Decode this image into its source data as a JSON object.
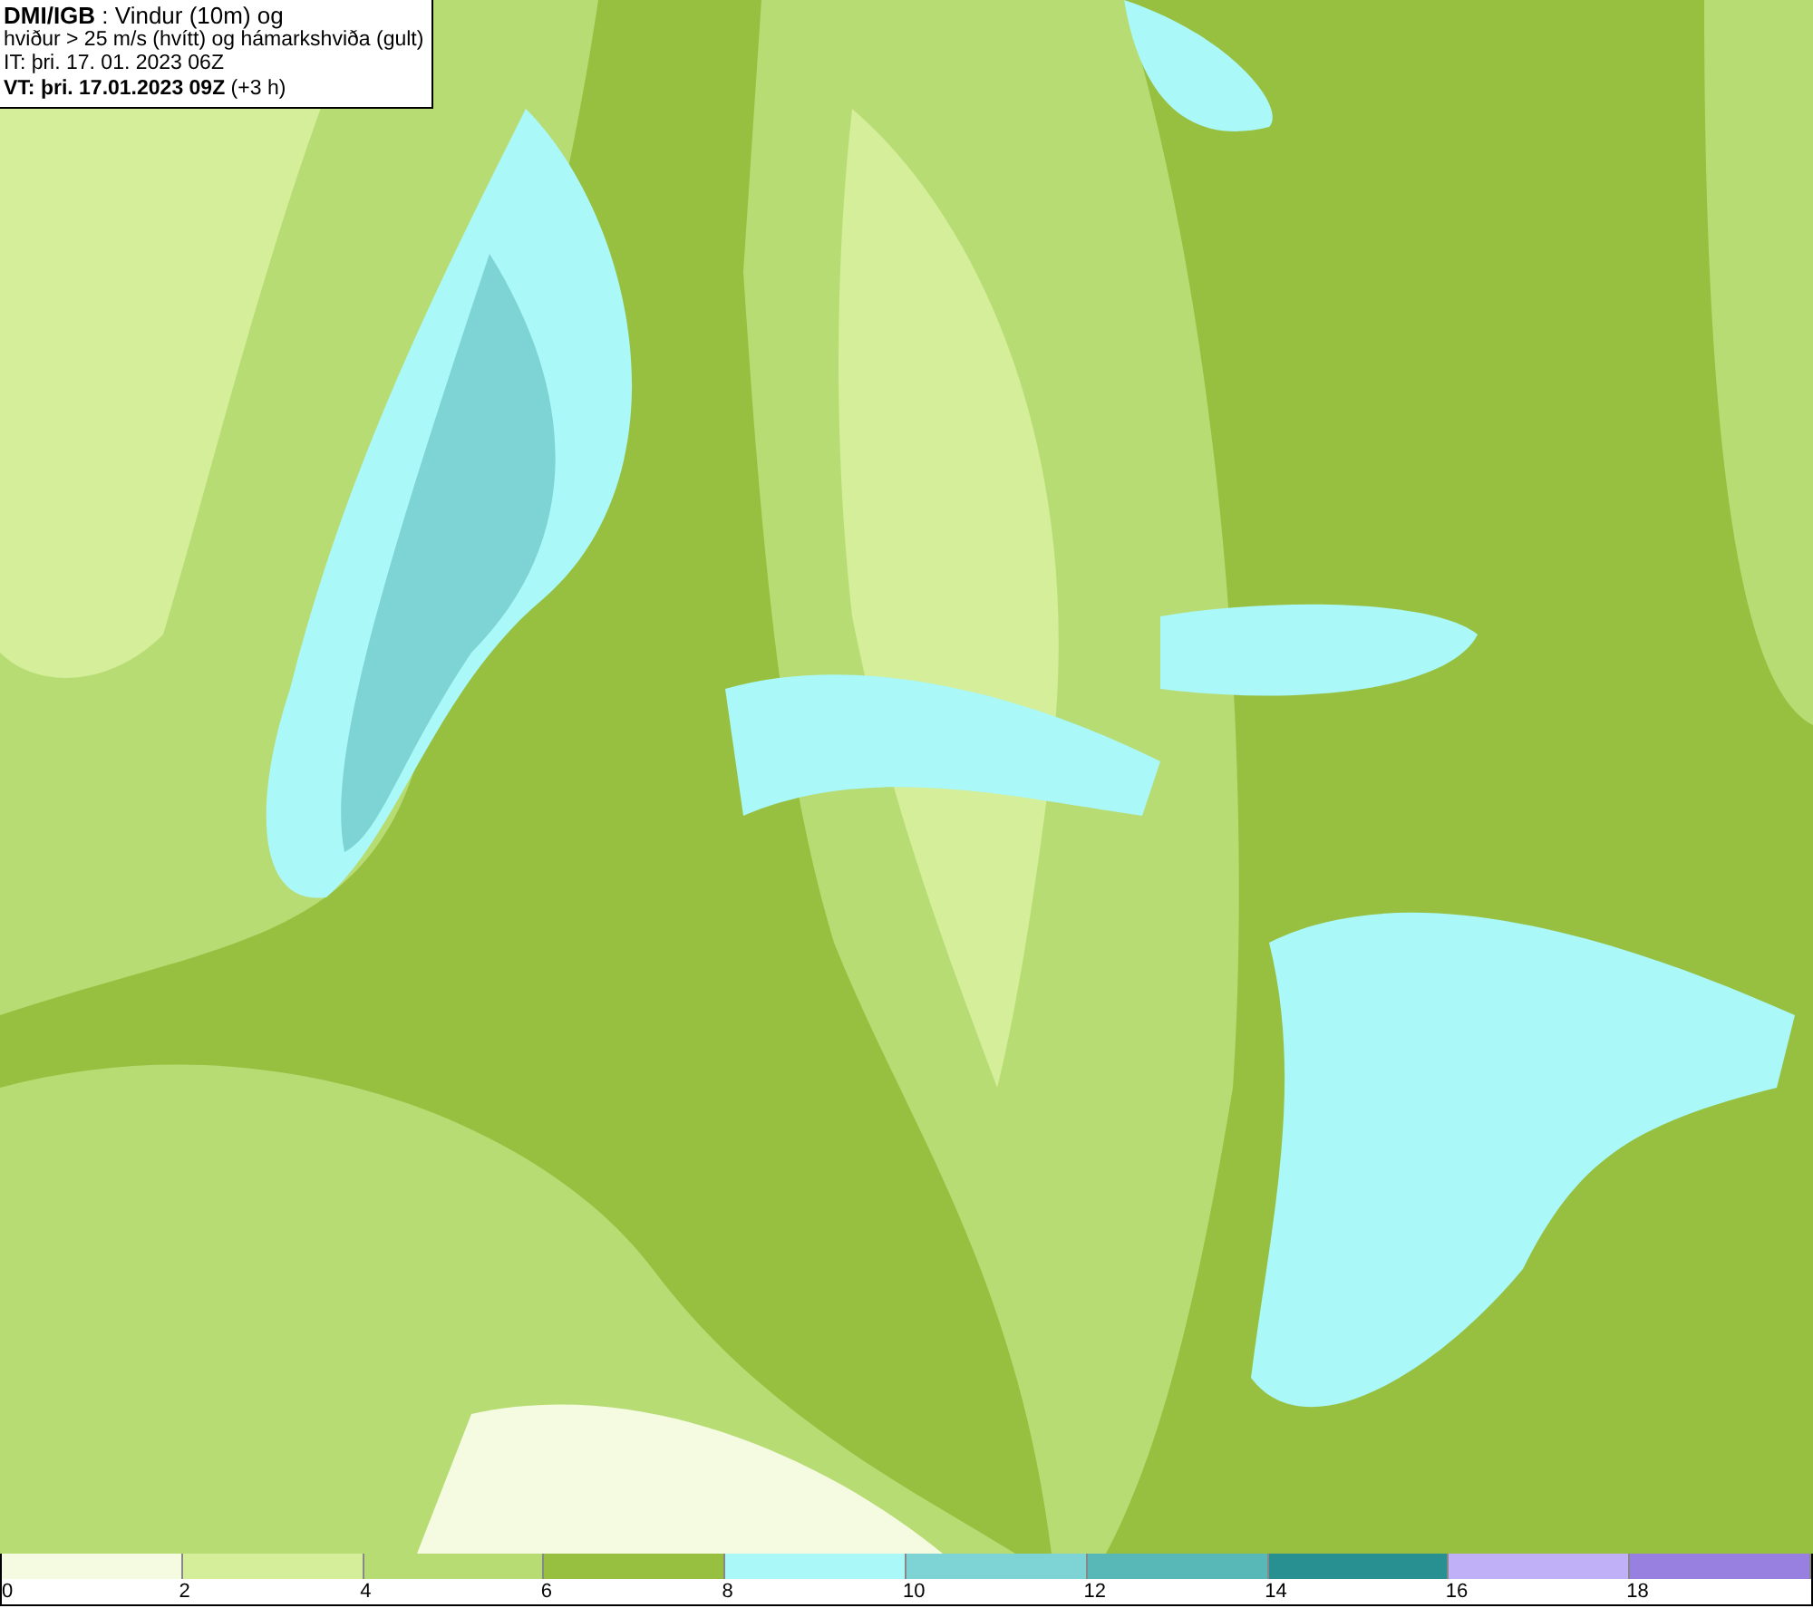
{
  "header": {
    "lines": [
      "**DMI/IGB** : Vindur (10m) og",
      "hviður > 25 m/s (hvítt) og hámarkshviða (gult)",
      "IT: þri. 17. 01. 2023 06Z",
      "**VT: þri. 17.01.2023 09Z** (+3 h)"
    ]
  },
  "legend": [
    {
      "label": "0",
      "color": "#f4fbe0"
    },
    {
      "label": "2",
      "color": "#d4ee9a"
    },
    {
      "label": "4",
      "color": "#b8dc74"
    },
    {
      "label": "6",
      "color": "#98c040"
    },
    {
      "label": "8",
      "color": "#aaf8f8"
    },
    {
      "label": "10",
      "color": "#7ed4d4"
    },
    {
      "label": "12",
      "color": "#58b8b8"
    },
    {
      "label": "14",
      "color": "#289090"
    },
    {
      "label": "16",
      "color": "#c0b0f8"
    },
    {
      "label": "18",
      "color": "#9880e0"
    }
  ]
}
